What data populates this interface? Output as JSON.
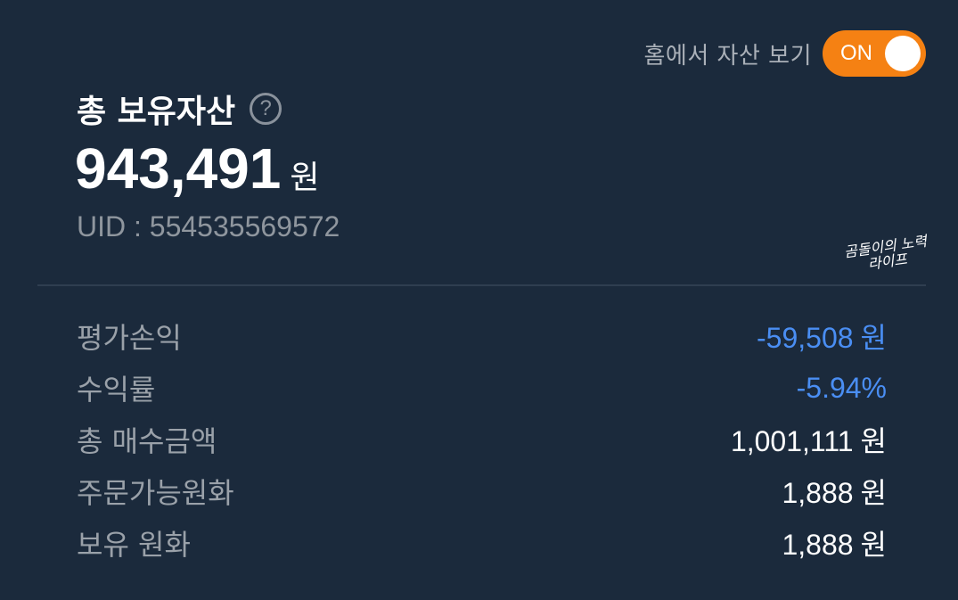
{
  "header": {
    "toggle_label": "홈에서 자산 보기",
    "toggle_state": "ON",
    "toggle_color": "#f58113"
  },
  "summary": {
    "title": "총 보유자산",
    "help_icon": "?",
    "total_amount": "943,491",
    "total_unit": "원",
    "uid": "UID : 554535569572"
  },
  "watermark": {
    "line1": "곰돌이의 노력",
    "line2": "라이프"
  },
  "stats": {
    "items": [
      {
        "label": "평가손익",
        "value": "-59,508",
        "unit": "원",
        "negative": true
      },
      {
        "label": "수익률",
        "value": "-5.94%",
        "unit": "",
        "negative": true
      },
      {
        "label": "총 매수금액",
        "value": "1,001,111",
        "unit": "원",
        "negative": false
      },
      {
        "label": "주문가능원화",
        "value": "1,888",
        "unit": "원",
        "negative": false
      },
      {
        "label": "보유 원화",
        "value": "1,888",
        "unit": "원",
        "negative": false
      }
    ],
    "negative_color": "#4a8ef3"
  }
}
